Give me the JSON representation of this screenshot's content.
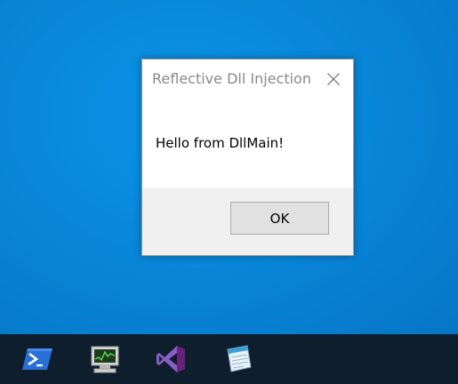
{
  "dialog": {
    "title": "Reflective Dll Injection",
    "message": "Hello from DllMain!",
    "ok_label": "OK"
  },
  "taskbar": {
    "icons": [
      {
        "name": "powershell-icon"
      },
      {
        "name": "task-manager-icon"
      },
      {
        "name": "visual-studio-icon"
      },
      {
        "name": "notepad-icon"
      }
    ]
  },
  "colors": {
    "desktop": "#0a86d8",
    "taskbar": "#0f1e2c",
    "title_text": "#8a8a8a",
    "footer": "#f0f0f0",
    "button_face": "#e1e1e1"
  }
}
